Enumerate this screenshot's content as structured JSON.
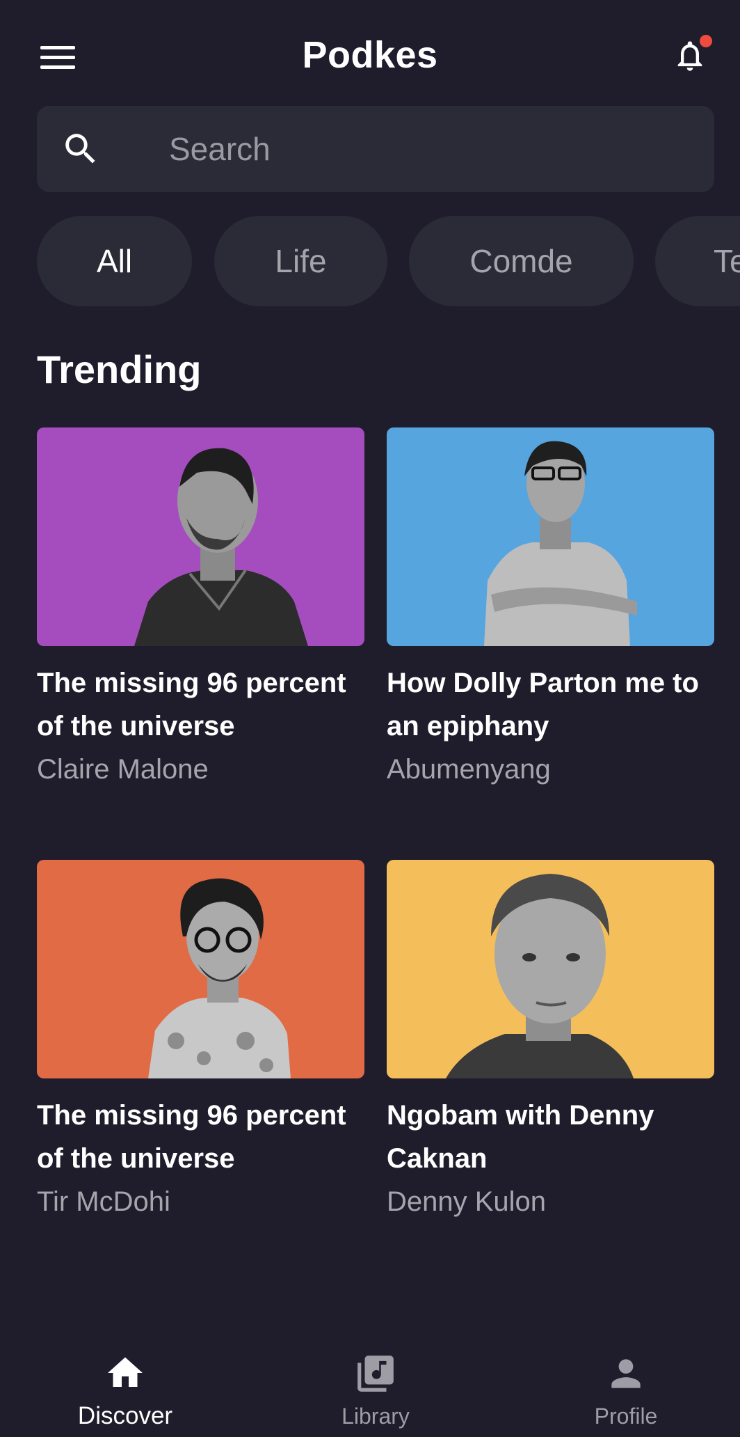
{
  "app": {
    "title": "Podkes"
  },
  "search": {
    "placeholder": "Search"
  },
  "chips": [
    {
      "label": "All",
      "active": true
    },
    {
      "label": "Life",
      "active": false
    },
    {
      "label": "Comde",
      "active": false
    },
    {
      "label": "Te",
      "active": false
    }
  ],
  "section": {
    "title": "Trending"
  },
  "cards": [
    {
      "title": "The missing 96 percent of the universe",
      "author": "Claire Malone",
      "bg": "#a54dbf"
    },
    {
      "title": "How Dolly Parton me to an epiphany",
      "author": "Abumenyang",
      "bg": "#56a5df"
    },
    {
      "title": "The missing 96 percent of the universe",
      "author": " Tir McDohi",
      "bg": "#e06b45"
    },
    {
      "title": "Ngobam with Denny Caknan",
      "author": "Denny Kulon",
      "bg": "#f4bf5a"
    }
  ],
  "tabs": [
    {
      "label": "Discover",
      "icon": "home-icon",
      "active": true
    },
    {
      "label": "Library",
      "icon": "library-music-icon",
      "active": false
    },
    {
      "label": "Profile",
      "icon": "person-icon",
      "active": false
    }
  ],
  "colors": {
    "background": "#1f1d2b",
    "surface": "#2b2a37",
    "notification": "#ef4b3f"
  }
}
